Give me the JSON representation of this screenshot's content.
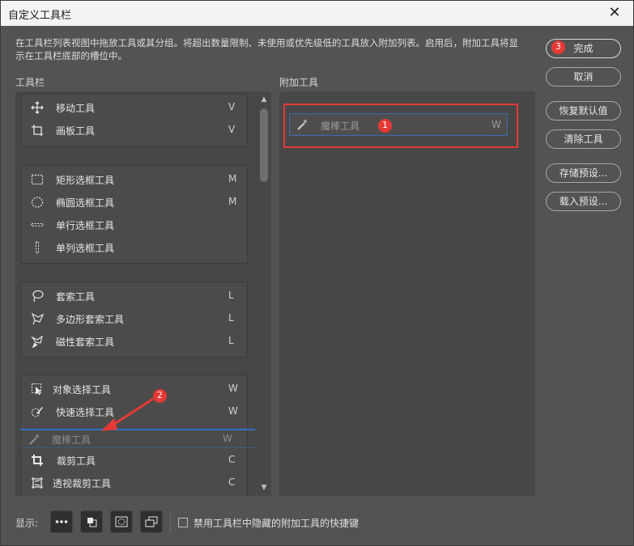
{
  "window": {
    "title": "自定义工具栏",
    "close_glyph": "✕"
  },
  "description": "在工具栏列表视图中拖放工具或其分组。将超出数量限制、未使用或优先级低的工具放入附加列表。启用后，附加工具将显示在工具栏底部的槽位中。",
  "toolbar_label": "工具栏",
  "extra_label": "附加工具",
  "groups": [
    {
      "tools": [
        {
          "name": "移动工具",
          "key": "V",
          "icon": "move-icon"
        },
        {
          "name": "画板工具",
          "key": "V",
          "icon": "artboard-icon"
        }
      ]
    },
    {
      "tools": [
        {
          "name": "矩形选框工具",
          "key": "M",
          "icon": "rect-marquee-icon"
        },
        {
          "name": "椭圆选框工具",
          "key": "M",
          "icon": "ellipse-marquee-icon"
        },
        {
          "name": "单行选框工具",
          "key": "",
          "icon": "single-row-marquee-icon"
        },
        {
          "name": "单列选框工具",
          "key": "",
          "icon": "single-column-marquee-icon"
        }
      ]
    },
    {
      "tools": [
        {
          "name": "套索工具",
          "key": "L",
          "icon": "lasso-icon"
        },
        {
          "name": "多边形套索工具",
          "key": "L",
          "icon": "polygon-lasso-icon"
        },
        {
          "name": "磁性套索工具",
          "key": "L",
          "icon": "magnetic-lasso-icon"
        }
      ]
    },
    {
      "tools": [
        {
          "name": "对象选择工具",
          "key": "W",
          "icon": "object-select-icon"
        },
        {
          "name": "快速选择工具",
          "key": "W",
          "icon": "quick-select-icon"
        },
        {
          "name": "裁剪工具",
          "key": "C",
          "icon": "crop-icon"
        },
        {
          "name": "透视裁剪工具",
          "key": "C",
          "icon": "perspective-crop-icon"
        }
      ]
    }
  ],
  "dragging_tool": {
    "name": "魔棒工具",
    "key": "W",
    "icon": "magic-wand-icon"
  },
  "extra_tool": {
    "name": "魔棒工具",
    "key": "W",
    "icon": "magic-wand-icon"
  },
  "buttons": {
    "done": "完成",
    "cancel": "取消",
    "restore": "恢复默认值",
    "clear": "清除工具",
    "save_preset": "存储预设...",
    "load_preset": "载入预设..."
  },
  "annotations": {
    "badge1": "1",
    "badge2": "2",
    "badge3": "3"
  },
  "footer": {
    "show_label": "显示:",
    "disable_shortcuts": "禁用工具栏中隐藏的附加工具的快捷键"
  },
  "colors": {
    "badge": "#e53935",
    "highlight_box": "#e53935",
    "drop_line": "#2f6fc2",
    "dialog_bg": "#535353"
  }
}
